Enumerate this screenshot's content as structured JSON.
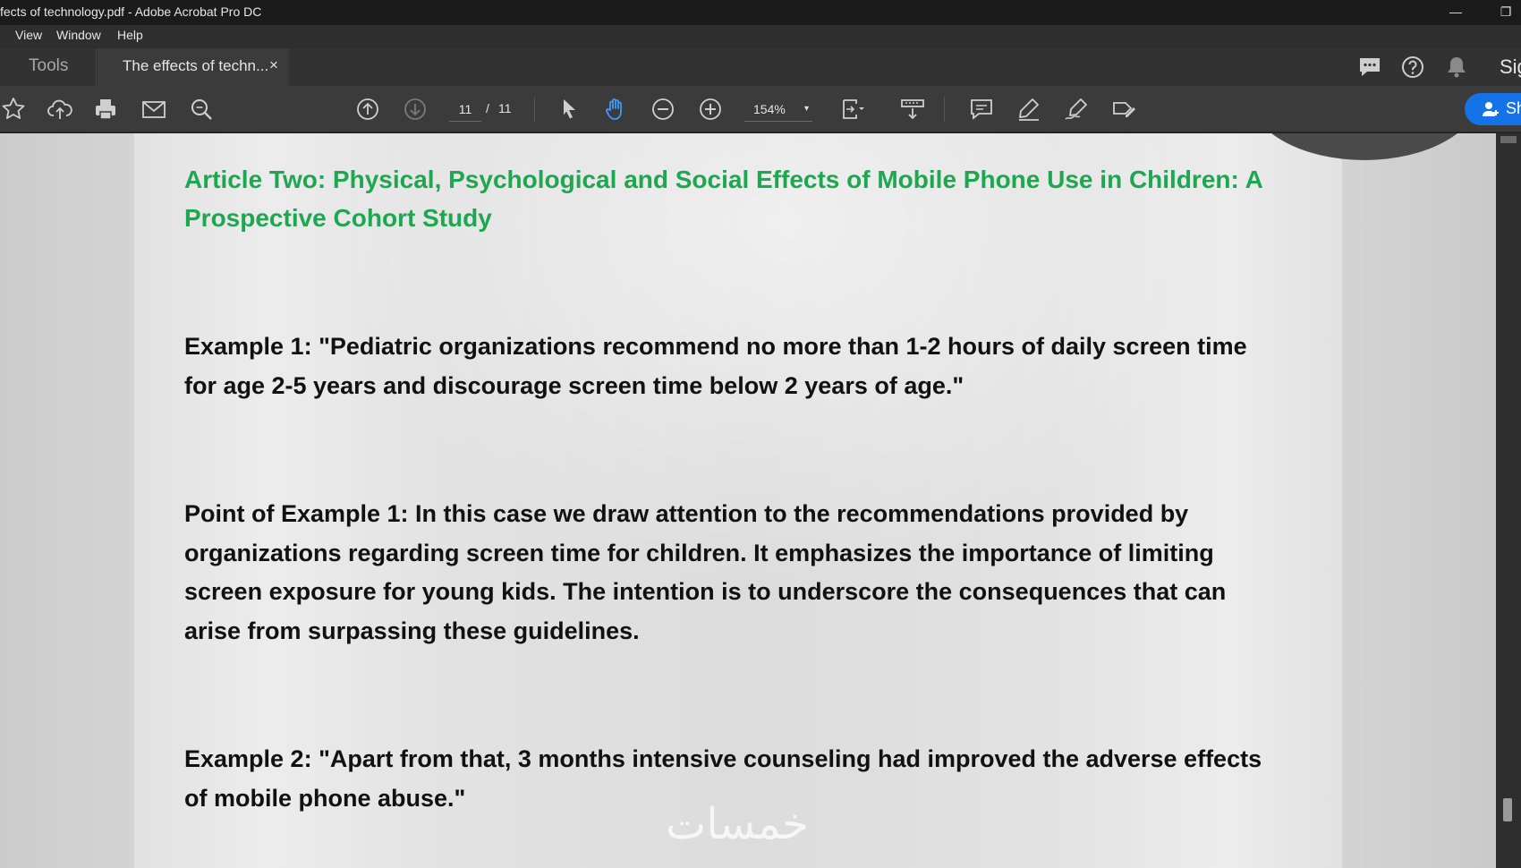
{
  "window": {
    "title": "fects of technology.pdf - Adobe Acrobat Pro DC",
    "minimize_glyph": "—",
    "restore_glyph": "❐"
  },
  "menu": {
    "items": [
      "View",
      "Window",
      "Help"
    ]
  },
  "tabs": {
    "tools_label": "Tools",
    "doc_label": "The effects of techn...",
    "close_glyph": "×",
    "sign_label": "Sig"
  },
  "toolbar": {
    "page_current": "11",
    "page_separator": "/",
    "page_total": "11",
    "zoom": "154%",
    "zoom_caret": "▾",
    "share_label": "Sh"
  },
  "document": {
    "heading": "Article Two: Physical, Psychological and Social Effects of Mobile Phone Use in Children: A Prospective Cohort Study",
    "paragraphs": [
      "Example 1: \"Pediatric organizations recommend no more than 1-2 hours of daily screen time for age 2-5 years and discourage screen time below 2 years of age.\"",
      "Point of Example 1: In this case we draw attention to the recommendations provided by organizations regarding screen time for children. It emphasizes the importance of limiting screen exposure for young kids. The intention is to underscore the consequences that can arise from surpassing these guidelines.",
      "Example 2: \"Apart from that, 3 months intensive counseling had improved the adverse effects of mobile phone abuse.\""
    ],
    "watermark": "خمسات"
  },
  "colors": {
    "heading_green": "#1ea750",
    "accent_blue": "#1473e6"
  }
}
